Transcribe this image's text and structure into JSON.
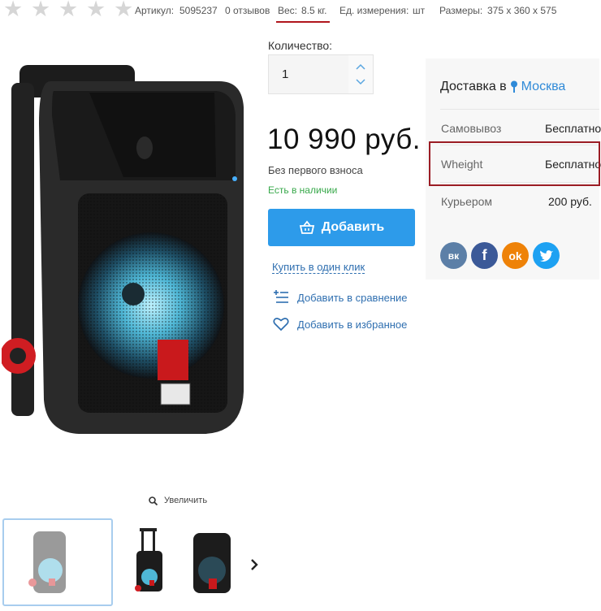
{
  "rating": {
    "stars": 5,
    "filled": 0
  },
  "meta": {
    "article_label": "Артикул:",
    "article_value": "5095237",
    "reviews_link": "0 отзывов",
    "weight_label": "Вес:",
    "weight_value": "8.5 кг.",
    "unit_label": "Ед. измерения:",
    "unit_value": "шт",
    "sizes_label": "Размеры:",
    "sizes_value": "375 x 360 x 575"
  },
  "quantity": {
    "label": "Количество:",
    "value": "1"
  },
  "price": "10 990 руб.",
  "no_down_payment": "Без первого взноса",
  "stock_status": "Есть в наличии",
  "add_button": "Добавить",
  "one_click": "Купить в один клик",
  "compare": "Добавить в сравнение",
  "favorites": "Добавить в избранное",
  "delivery": {
    "title": "Доставка в",
    "city": "Москва",
    "rows": [
      {
        "key": "Самовывоз",
        "value": "Бесплатно"
      },
      {
        "key": "Wheight",
        "value": "Бесплатно"
      },
      {
        "key": "Курьером",
        "value": "200 руб."
      }
    ]
  },
  "social": [
    "vk",
    "facebook",
    "odnoklassniki",
    "twitter"
  ],
  "social_labels": {
    "vk": "вк",
    "facebook": "f",
    "odnoklassniki": "ok",
    "twitter": "t"
  },
  "zoom": "Увеличить",
  "colors": {
    "accent": "#2d9bea",
    "link": "#2f8ad8",
    "stock": "#37a84a",
    "highlight": "#9b1c24"
  }
}
